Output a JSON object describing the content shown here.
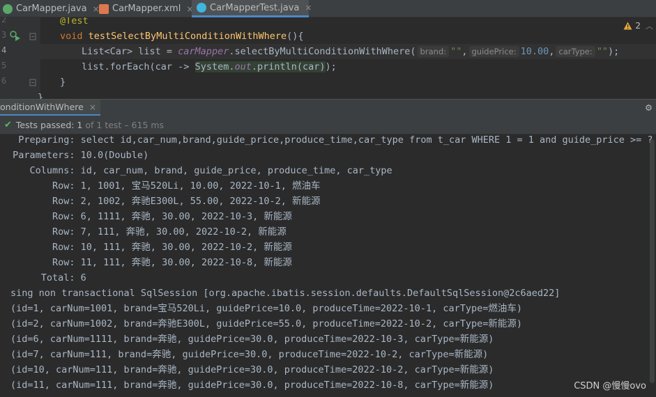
{
  "tabs": [
    {
      "label": "CarMapper.java",
      "icon": "java-interface-icon",
      "color": "#59a869",
      "active": false
    },
    {
      "label": "CarMapper.xml",
      "icon": "xml-file-icon",
      "color": "#e0784f",
      "active": false
    },
    {
      "label": "CarMapperTest.java",
      "icon": "java-class-icon",
      "color": "#40b6e0",
      "active": true
    }
  ],
  "tab_close": "×",
  "editor": {
    "line_numbers": [
      "2",
      "3",
      "4",
      "5",
      "6"
    ],
    "annotation": "@Test",
    "line3_kw": "void",
    "line3_fn": "testSelectByMultiConditionWithWhere",
    "line3_rest": "(){",
    "line4_a": "List<Car> list = ",
    "line4_field": "carMapper",
    "line4_b": ".selectByMultiConditionWithWhere(",
    "hint_brand": "brand:",
    "arg_brand": "\"\"",
    "hint_price": "guidePrice:",
    "arg_price": "10.00",
    "hint_type": "carType:",
    "arg_type": "\"\"",
    "line4_end": ");",
    "line5_a": "list.forEach(car -> ",
    "line5_sys": "System.",
    "line5_out": "out",
    "line5_b": ".println(car)",
    "line5_end": ");",
    "line6": "}",
    "line7": "}",
    "warnings": "2"
  },
  "run": {
    "tab_label": "onditionWithWhere",
    "tests_passed": "Tests passed: 1",
    "detail": "of 1 test – 615 ms"
  },
  "console_lines": [
    "  Preparing: select id,car_num,brand,guide_price,produce_time,car_type from t_car WHERE 1 = 1 and guide_price >= ?",
    " Parameters: 10.0(Double)",
    "    Columns: id, car_num, brand, guide_price, produce_time, car_type",
    "        Row: 1, 1001, 宝马520Li, 10.00, 2022-10-1, 燃油车",
    "        Row: 2, 1002, 奔驰E300L, 55.00, 2022-10-2, 新能源",
    "        Row: 6, 1111, 奔驰, 30.00, 2022-10-3, 新能源",
    "        Row: 7, 111, 奔驰, 30.00, 2022-10-2, 新能源",
    "        Row: 10, 111, 奔驰, 30.00, 2022-10-2, 新能源",
    "        Row: 11, 111, 奔驰, 30.00, 2022-10-8, 新能源",
    "      Total: 6",
    "sing non transactional SqlSession [org.apache.ibatis.session.defaults.DefaultSqlSession@2c6aed22]",
    "(id=1, carNum=1001, brand=宝马520Li, guidePrice=10.0, produceTime=2022-10-1, carType=燃油车)",
    "(id=2, carNum=1002, brand=奔驰E300L, guidePrice=55.0, produceTime=2022-10-2, carType=新能源)",
    "(id=6, carNum=1111, brand=奔驰, guidePrice=30.0, produceTime=2022-10-3, carType=新能源)",
    "(id=7, carNum=111, brand=奔驰, guidePrice=30.0, produceTime=2022-10-2, carType=新能源)",
    "(id=10, carNum=111, brand=奔驰, guidePrice=30.0, produceTime=2022-10-2, carType=新能源)",
    "(id=11, carNum=111, brand=奔驰, guidePrice=30.0, produceTime=2022-10-8, carType=新能源)"
  ],
  "watermark": "CSDN @慢慢ovo"
}
